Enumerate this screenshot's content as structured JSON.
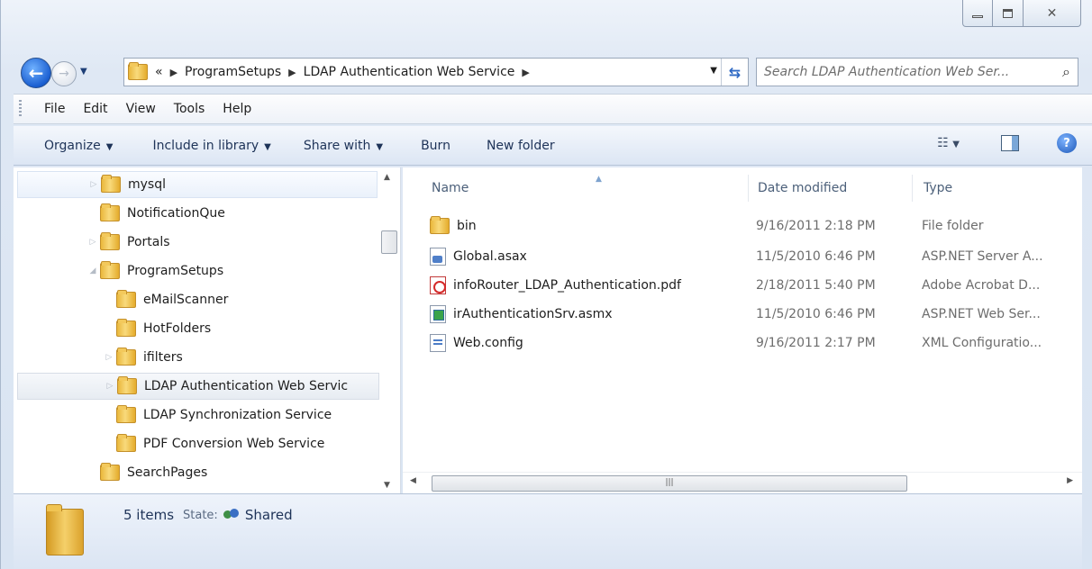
{
  "address": {
    "overflow": "«",
    "crumbs": [
      "ProgramSetups",
      "LDAP Authentication Web Service"
    ],
    "search_placeholder": "Search LDAP Authentication Web Ser..."
  },
  "menu": [
    "File",
    "Edit",
    "View",
    "Tools",
    "Help"
  ],
  "commands": [
    "Organize",
    "Include in library",
    "Share with",
    "Burn",
    "New folder"
  ],
  "tree": [
    {
      "label": "mysql"
    },
    {
      "label": "NotificationQue"
    },
    {
      "label": "Portals"
    },
    {
      "label": "ProgramSetups"
    },
    {
      "label": "eMailScanner"
    },
    {
      "label": "HotFolders"
    },
    {
      "label": "ifilters"
    },
    {
      "label": "LDAP Authentication Web Servic"
    },
    {
      "label": "LDAP Synchronization Service"
    },
    {
      "label": "PDF Conversion Web Service"
    },
    {
      "label": "SearchPages"
    }
  ],
  "columns": {
    "name": "Name",
    "date": "Date modified",
    "type": "Type"
  },
  "files": [
    {
      "name": "bin",
      "date": "9/16/2011 2:18 PM",
      "type": "File folder",
      "icon": "folder-icon"
    },
    {
      "name": "Global.asax",
      "date": "11/5/2010 6:46 PM",
      "type": "ASP.NET Server A...",
      "icon": "asax-file-icon"
    },
    {
      "name": "infoRouter_LDAP_Authentication.pdf",
      "date": "2/18/2011 5:40 PM",
      "type": "Adobe Acrobat D...",
      "icon": "pdf-file-icon"
    },
    {
      "name": "irAuthenticationSrv.asmx",
      "date": "11/5/2010 6:46 PM",
      "type": "ASP.NET Web Ser...",
      "icon": "asmx-file-icon"
    },
    {
      "name": "Web.config",
      "date": "9/16/2011 2:17 PM",
      "type": "XML Configuratio...",
      "icon": "config-file-icon"
    }
  ],
  "details": {
    "count": "5 items",
    "state_label": "State:",
    "state_value": "Shared"
  }
}
